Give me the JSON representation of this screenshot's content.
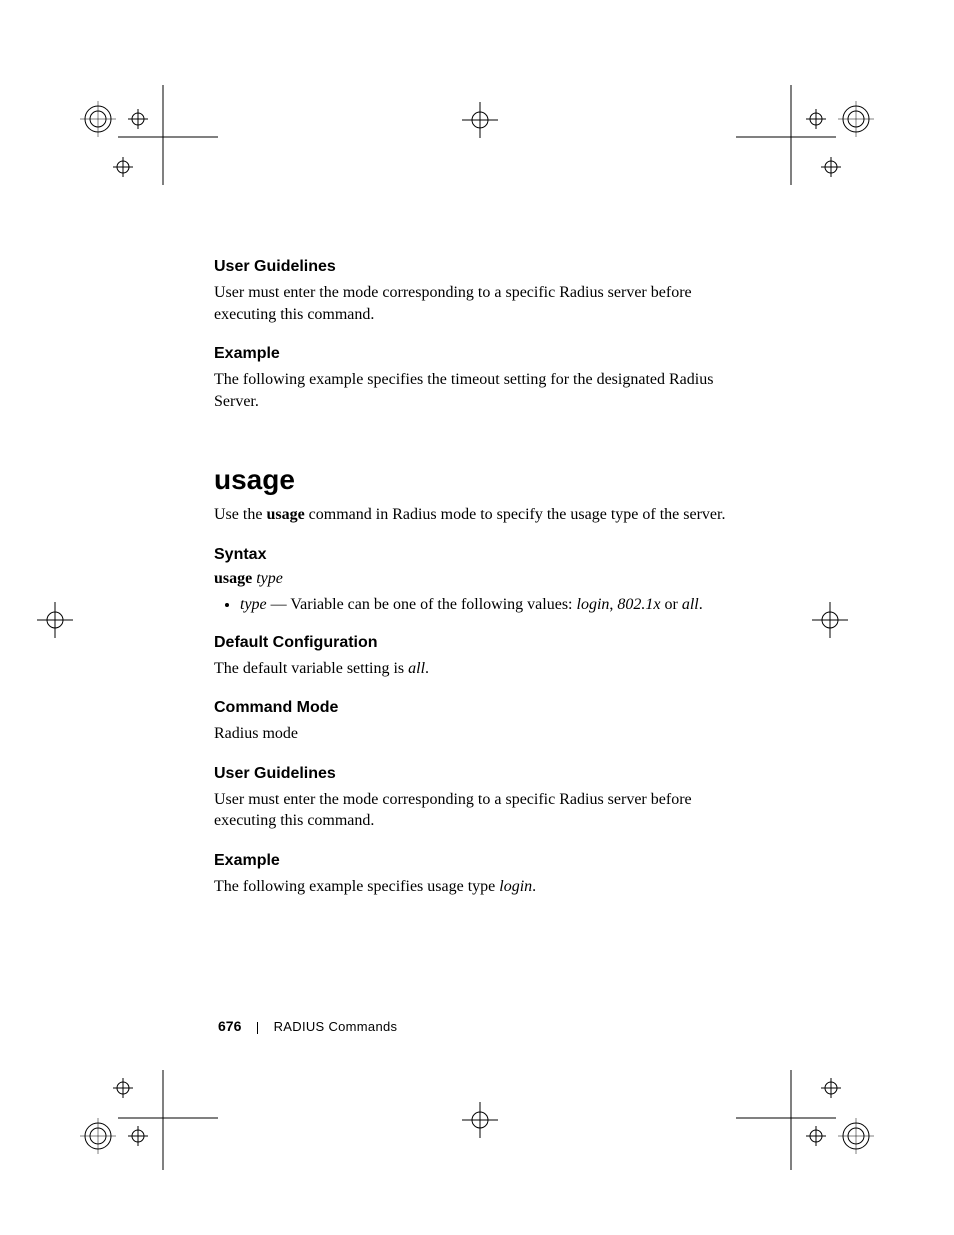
{
  "sections": {
    "user_guidelines_1": {
      "heading": "User Guidelines",
      "body": "User must enter the mode corresponding to a specific Radius server before executing this command."
    },
    "example_1": {
      "heading": "Example",
      "body": "The following example specifies the timeout setting for the designated Radius Server."
    },
    "command_title": "usage",
    "command_intro_pre": "Use the ",
    "command_intro_bold": "usage",
    "command_intro_post": " command in Radius mode to specify the usage type of the server.",
    "syntax": {
      "heading": "Syntax",
      "line_bold": "usage ",
      "line_italic": "type",
      "bullet_type": "type",
      "bullet_mid": " — Variable can be one of the following values: ",
      "bullet_val1": "login",
      "bullet_sep1": ", ",
      "bullet_val2": "802.1x",
      "bullet_sep2": " or ",
      "bullet_val3": "all",
      "bullet_end": "."
    },
    "default_config": {
      "heading": "Default Configuration",
      "body_pre": "The default variable setting is ",
      "body_italic": "all",
      "body_post": "."
    },
    "command_mode": {
      "heading": "Command Mode",
      "body": " Radius mode"
    },
    "user_guidelines_2": {
      "heading": "User Guidelines",
      "body": "User must enter the mode corresponding to a specific Radius server before executing this command."
    },
    "example_2": {
      "heading": "Example",
      "body_pre": "The following example specifies usage type ",
      "body_italic": "login",
      "body_post": "."
    }
  },
  "footer": {
    "page_number": "676",
    "section_name": "RADIUS Commands"
  }
}
